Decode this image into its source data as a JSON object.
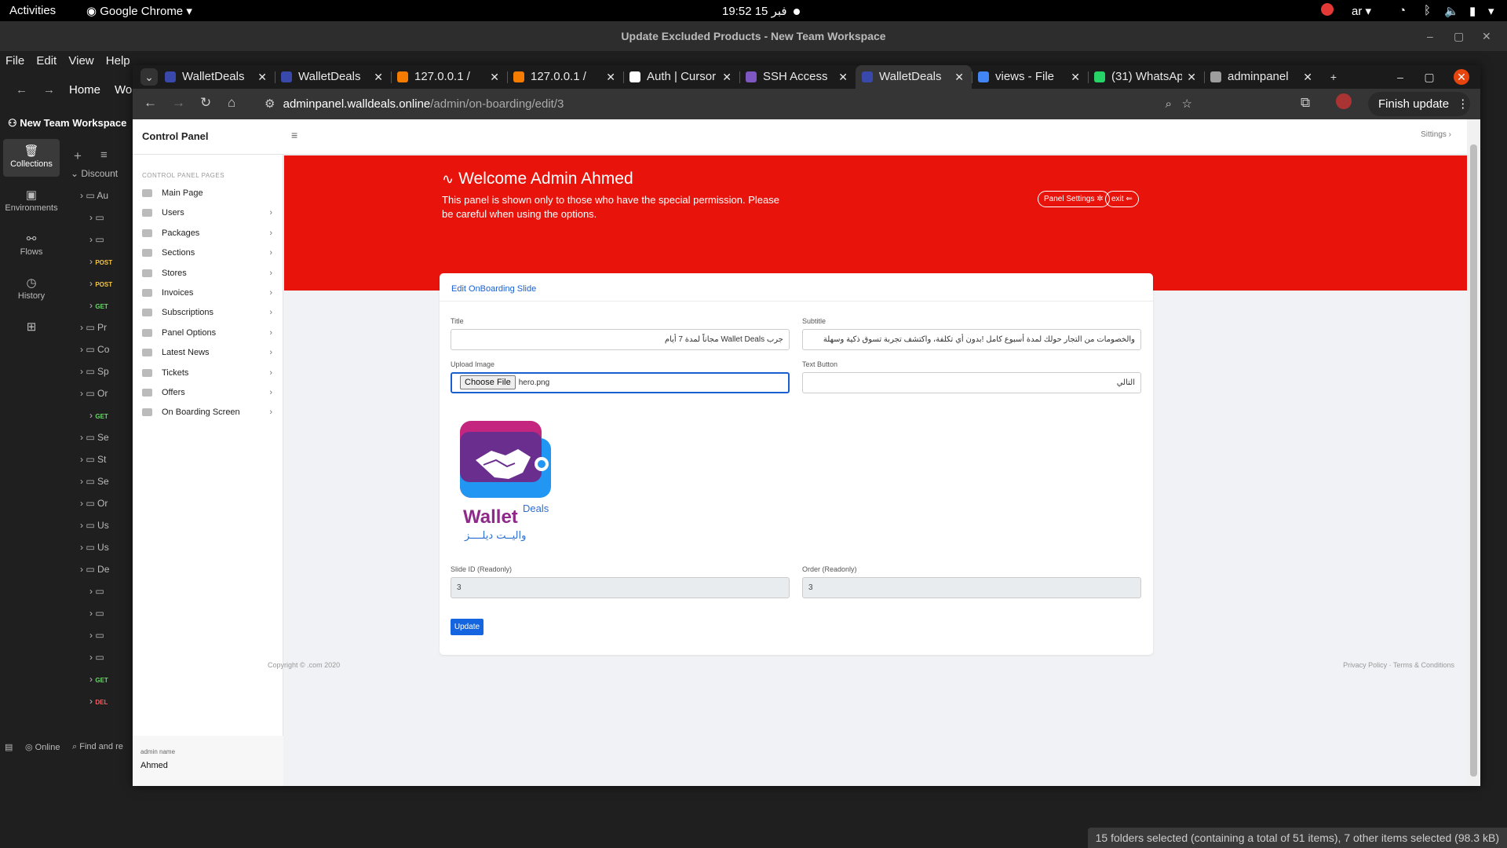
{
  "os": {
    "activities": "Activities",
    "app": "Google Chrome",
    "clock": "19:52  15 فبر",
    "lang": "ar"
  },
  "bg": {
    "window_title": "Update Excluded Products - New Team Workspace",
    "menu": [
      "File",
      "Edit",
      "View",
      "Help"
    ],
    "home": "Home",
    "wo": "Wo",
    "workspace": "New Team Workspace",
    "rail": [
      "Collections",
      "Environments",
      "Flows",
      "History"
    ],
    "tree_root": "Discount",
    "tree": [
      {
        "text": "Au",
        "method": ""
      },
      {
        "text": "",
        "method": ""
      },
      {
        "text": "",
        "method": ""
      },
      {
        "text": "",
        "method": "POST"
      },
      {
        "text": "",
        "method": "POST"
      },
      {
        "text": "",
        "method": "GET"
      },
      {
        "text": "Pr",
        "method": ""
      },
      {
        "text": "Co",
        "method": ""
      },
      {
        "text": "Sp",
        "method": ""
      },
      {
        "text": "Or",
        "method": ""
      },
      {
        "text": "",
        "method": "GET"
      },
      {
        "text": "Se",
        "method": ""
      },
      {
        "text": "St",
        "method": ""
      },
      {
        "text": "Se",
        "method": ""
      },
      {
        "text": "Or",
        "method": ""
      },
      {
        "text": "Us",
        "method": ""
      },
      {
        "text": "Us",
        "method": ""
      },
      {
        "text": "De",
        "method": ""
      },
      {
        "text": "",
        "method": ""
      },
      {
        "text": "",
        "method": ""
      },
      {
        "text": "",
        "method": ""
      },
      {
        "text": "",
        "method": ""
      },
      {
        "text": "",
        "method": "GET"
      },
      {
        "text": "",
        "method": "DEL"
      }
    ],
    "online": "Online",
    "find": "Find and re",
    "status": "15 folders selected (containing a total of 51 items), 7 other items selected (98.3 kB)"
  },
  "chrome": {
    "tabs": [
      {
        "label": "WalletDeals",
        "color": "#3949ab"
      },
      {
        "label": "WalletDeals",
        "color": "#3949ab"
      },
      {
        "label": "127.0.0.1 / ",
        "color": "#f57c00"
      },
      {
        "label": "127.0.0.1 / ",
        "color": "#f57c00"
      },
      {
        "label": "Auth | Cursor",
        "color": "#ffffff"
      },
      {
        "label": "SSH Access",
        "color": "#7e57c2"
      },
      {
        "label": "WalletDeals",
        "color": "#3949ab"
      },
      {
        "label": "views - File",
        "color": "#4285f4"
      },
      {
        "label": "(31) WhatsApp",
        "color": "#25d366"
      },
      {
        "label": "adminpanel",
        "color": "#9e9e9e"
      }
    ],
    "url_host": "adminpanel.walldeals.online",
    "url_path": "/admin/on-boarding/edit/3",
    "finish": "Finish update"
  },
  "app": {
    "brand": "Control Panel",
    "sittings": "Sittings",
    "sidebar_heading": "CONTROL PANEL PAGES",
    "sidebar": [
      {
        "label": "Main Page",
        "chev": false
      },
      {
        "label": "Users",
        "chev": true
      },
      {
        "label": "Packages",
        "chev": true
      },
      {
        "label": "Sections",
        "chev": true
      },
      {
        "label": "Stores",
        "chev": true
      },
      {
        "label": "Invoices",
        "chev": true
      },
      {
        "label": "Subscriptions",
        "chev": true
      },
      {
        "label": "Panel Options",
        "chev": true
      },
      {
        "label": "Latest News",
        "chev": true
      },
      {
        "label": "Tickets",
        "chev": true
      },
      {
        "label": "Offers",
        "chev": true
      },
      {
        "label": "On Boarding Screen",
        "chev": true
      }
    ],
    "admin_label": "admin name",
    "admin_name": "Ahmed",
    "welcome": "Welcome Admin Ahmed",
    "welcome_desc": "This panel is shown only to those who have the special permission. Please be careful when using the options.",
    "panel_settings": "Panel Settings",
    "exit": "exit",
    "card_title": "Edit OnBoarding Slide",
    "title_label": "Title",
    "title_value": "جرب Wallet Deals مجاناً لمدة 7 أيام",
    "subtitle_label": "Subtitle",
    "subtitle_value": "والخصومات من التجار حولك لمدة أسبوع كامل !بدون أي تكلفة، واكتشف تجربة تسوق ذكية وسهلة",
    "upload_label": "Upload Image",
    "choose_file": "Choose File",
    "file_name": "hero.png",
    "text_button_label": "Text Button",
    "text_button_value": "التالي",
    "logo_wallet": "Wallet",
    "logo_deals": "Deals",
    "logo_arabic": "واليــت ديلــــز",
    "slide_id_label": "Slide ID (Readonly)",
    "slide_id_value": "3",
    "order_label": "Order (Readonly)",
    "order_value": "3",
    "update": "Update",
    "copyright": "Copyright © .com 2020",
    "privacy": "Privacy Policy",
    "terms": "Terms & Conditions"
  }
}
